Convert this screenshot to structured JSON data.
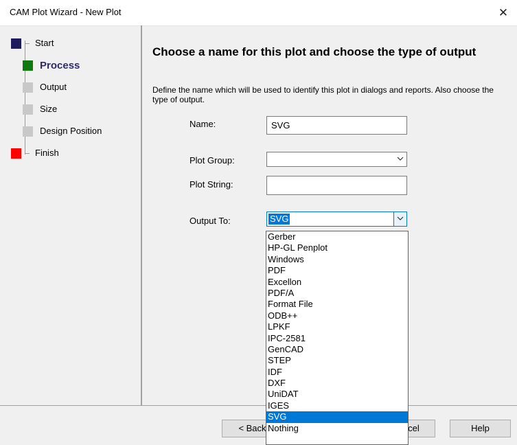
{
  "window": {
    "title": "CAM Plot  Wizard - New Plot",
    "close_glyph": "✕"
  },
  "steps": [
    {
      "label": "Start",
      "marker_color": "#1f1a5c",
      "state": "done"
    },
    {
      "label": "Process",
      "marker_color": "#0e7a0e",
      "state": "current"
    },
    {
      "label": "Output",
      "marker_color": "#c8c8c8",
      "state": "pending"
    },
    {
      "label": "Size",
      "marker_color": "#c8c8c8",
      "state": "pending"
    },
    {
      "label": "Design Position",
      "marker_color": "#c8c8c8",
      "state": "pending"
    },
    {
      "label": "Finish",
      "marker_color": "#ff0000",
      "state": "end"
    }
  ],
  "page": {
    "heading": "Choose a name for this plot and choose the type of output",
    "description": "Define the name which will be used to identify this plot in dialogs and reports. Also choose the type of output."
  },
  "form": {
    "name_label": "Name:",
    "name_value": "SVG",
    "plot_group_label": "Plot Group:",
    "plot_group_value": "",
    "plot_string_label": "Plot String:",
    "plot_string_value": "",
    "output_to_label": "Output To:",
    "output_to_value": "SVG"
  },
  "output_options": [
    "Gerber",
    "HP-GL Penplot",
    "Windows",
    "PDF",
    "Excellon",
    "PDF/A",
    "Format File",
    "ODB++",
    "LPKF",
    "IPC-2581",
    "GenCAD",
    "STEP",
    "IDF",
    "DXF",
    "UniDAT",
    "IGES",
    "SVG",
    "Nothing"
  ],
  "output_selected": "SVG",
  "buttons": {
    "back_label": "< Back",
    "cancel_label": "Cancel",
    "help_label": "Help"
  },
  "colors": {
    "accent": "#0078d7"
  }
}
